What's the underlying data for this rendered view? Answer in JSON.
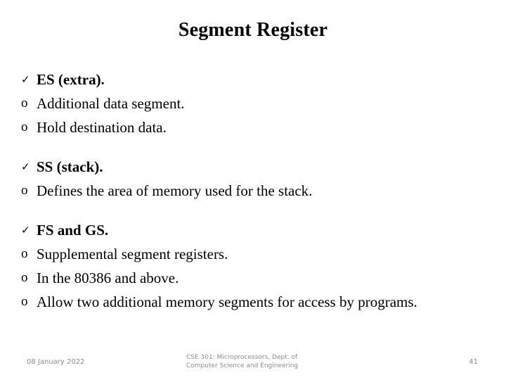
{
  "slide": {
    "title": "Segment Register",
    "groups": [
      {
        "heading": {
          "bullet": "check-bullet-icon",
          "glyph": "✓",
          "text": "ES (extra)."
        },
        "items": [
          {
            "bullet": "circle-bullet-icon",
            "glyph": "o",
            "text": "Additional data segment."
          },
          {
            "bullet": "circle-bullet-icon",
            "glyph": "o",
            "text": "Hold destination data."
          }
        ]
      },
      {
        "heading": {
          "bullet": "check-bullet-icon",
          "glyph": "✓",
          "text": "SS (stack)."
        },
        "items": [
          {
            "bullet": "circle-bullet-icon",
            "glyph": "o",
            "text": "Defines the area of memory used for the stack."
          }
        ]
      },
      {
        "heading": {
          "bullet": "check-bullet-icon",
          "glyph": "✓",
          "text": "FS and GS."
        },
        "items": [
          {
            "bullet": "circle-bullet-icon",
            "glyph": "o",
            "text": "Supplemental segment registers."
          },
          {
            "bullet": "circle-bullet-icon",
            "glyph": "o",
            "text": "In the 80386 and above."
          },
          {
            "bullet": "circle-bullet-icon",
            "glyph": "o",
            "text": "Allow two additional memory segments for access by programs."
          }
        ]
      }
    ]
  },
  "footer": {
    "date": "08 January 2022",
    "course_line_1": "CSE 301: Microprocessors, Dept. of",
    "course_line_2": "Computer Science and Engineering",
    "page_number": "41"
  },
  "colors": {
    "background": "#ffffff",
    "text": "#000000",
    "footer_text": "#8c8c8c"
  }
}
